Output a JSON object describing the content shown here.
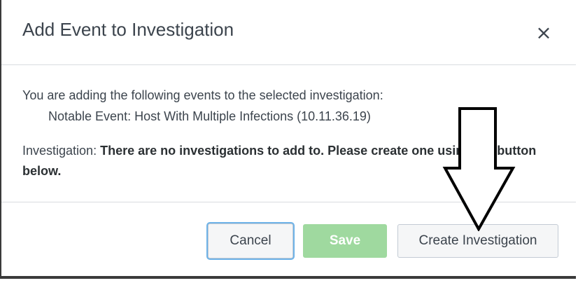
{
  "dialog": {
    "title": "Add Event to Investigation",
    "close_glyph": "×"
  },
  "body": {
    "intro": "You are adding the following events to the selected investigation:",
    "events": [
      "Notable Event: Host With Multiple Infections (10.11.36.19)"
    ],
    "investigation_label": "Investigation:",
    "investigation_message": "There are no investigations to add to. Please create one using the button below."
  },
  "footer": {
    "cancel_label": "Cancel",
    "save_label": "Save",
    "create_label": "Create Investigation"
  },
  "colors": {
    "save_disabled": "#9fd99f",
    "focus_ring": "#6fb3e8",
    "text": "#3c444d"
  },
  "annotations": {
    "arrow": "down-arrow pointing to Create Investigation button"
  }
}
